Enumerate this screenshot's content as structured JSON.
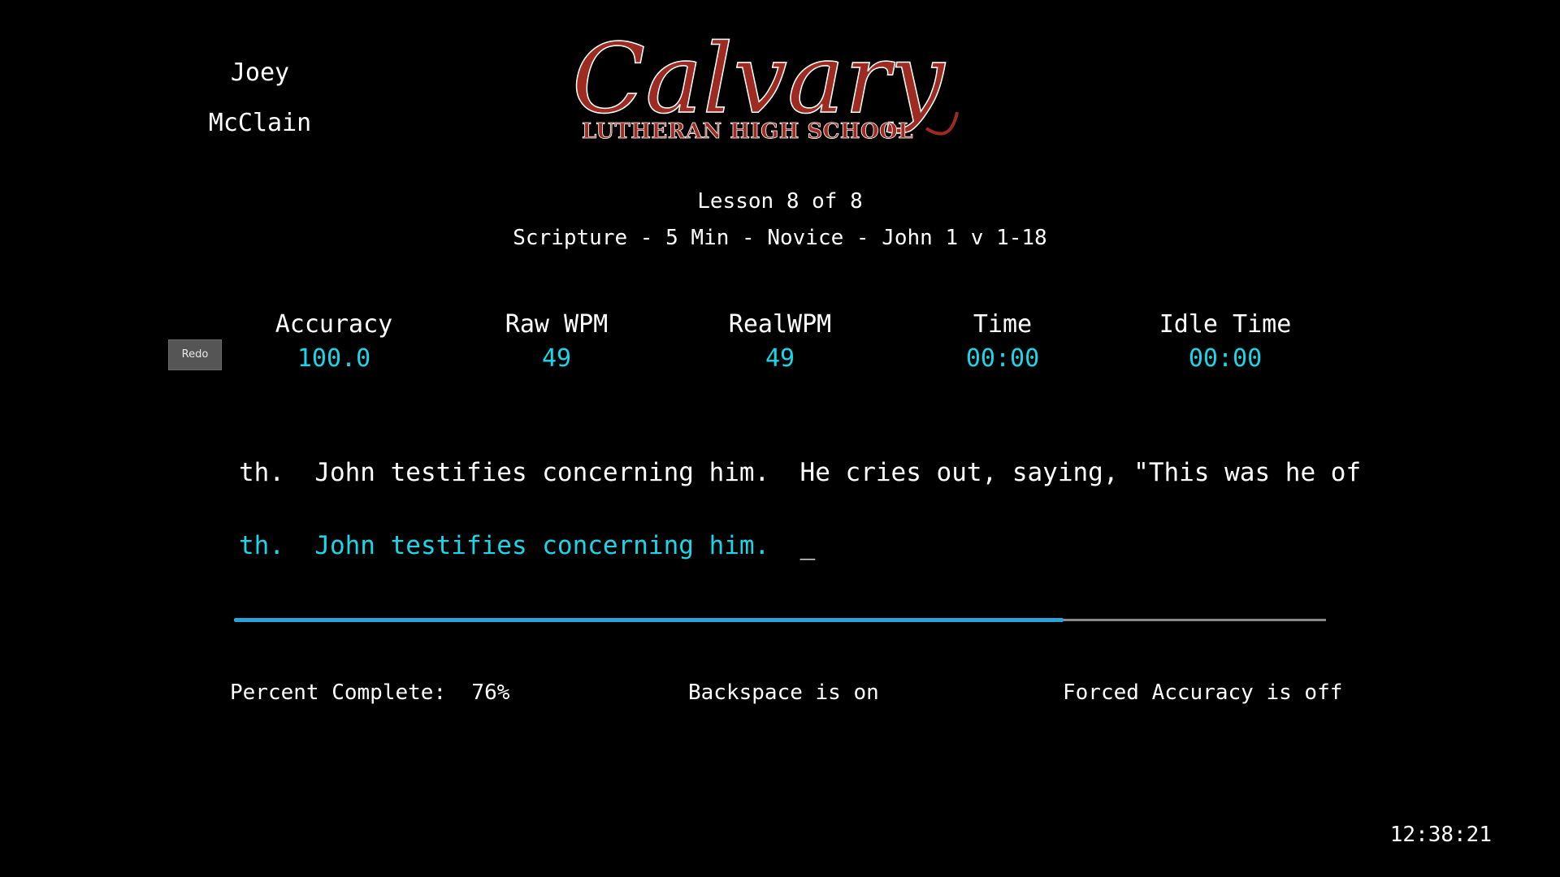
{
  "user": {
    "first_name": "Joey",
    "last_name": "McClain"
  },
  "logo": {
    "title": "Calvary",
    "subtitle": "Lutheran High School",
    "color": "#9e2b22"
  },
  "lesson": {
    "progress_label": "Lesson 8 of 8",
    "description": "Scripture - 5 Min - Novice - John 1 v 1-18"
  },
  "stats": {
    "accuracy": {
      "label": "Accuracy",
      "value": "100.0"
    },
    "raw_wpm": {
      "label": "Raw WPM",
      "value": "49"
    },
    "real_wpm": {
      "label": "RealWPM",
      "value": "49"
    },
    "time": {
      "label": "Time",
      "value": "00:00"
    },
    "idle_time": {
      "label": "Idle Time",
      "value": "00:00"
    }
  },
  "redo_button_label": "Redo",
  "typing": {
    "source_text": "th.  John testifies concerning him.  He cries out, saying, \"This was he of",
    "typed_text": "th.  John testifies concerning him.  ",
    "cursor": "_"
  },
  "progress": {
    "fraction": 0.76,
    "fill_color": "#2aa3dd"
  },
  "status": {
    "percent_complete_label": "Percent Complete:",
    "percent_complete_value": "76%",
    "backspace": "Backspace is on",
    "forced_accuracy": "Forced Accuracy is off"
  },
  "clock": "12:38:21",
  "colors": {
    "background": "#000000",
    "accent": "#19d6e8",
    "text": "#ffffff"
  }
}
